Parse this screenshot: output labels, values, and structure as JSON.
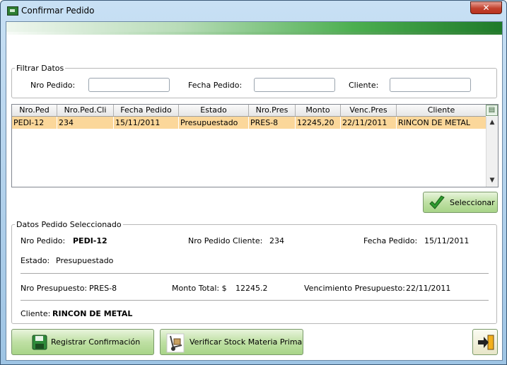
{
  "window": {
    "title": "Confirmar Pedido",
    "close_label": "✕"
  },
  "filter": {
    "legend": "Filtrar Datos",
    "nro_pedido_label": "Nro Pedido:",
    "nro_pedido_value": "",
    "fecha_pedido_label": "Fecha Pedido:",
    "fecha_pedido_value": "",
    "cliente_label": "Cliente:",
    "cliente_value": ""
  },
  "table": {
    "columns": [
      "Nro.Ped",
      "Nro.Ped.Cli",
      "Fecha Pedido",
      "Estado",
      "Nro.Pres",
      "Monto",
      "Venc.Pres",
      "Cliente"
    ],
    "rows": [
      [
        "PEDI-12",
        "234",
        "15/11/2011",
        "Presupuestado",
        "PRES-8",
        "12245,20",
        "22/11/2011",
        "RINCON DE METAL"
      ]
    ]
  },
  "seleccionar_label": "Seleccionar",
  "details": {
    "legend": "Datos Pedido Seleccionado",
    "nro_pedido_label": "Nro Pedido:",
    "nro_pedido_value": "PEDI-12",
    "nro_pedido_cliente_label": "Nro Pedido Cliente:",
    "nro_pedido_cliente_value": "234",
    "fecha_pedido_label": "Fecha Pedido:",
    "fecha_pedido_value": "15/11/2011",
    "estado_label": "Estado:",
    "estado_value": "Presupuestado",
    "nro_presupuesto_label": "Nro Presupuesto:",
    "nro_presupuesto_value": "PRES-8",
    "monto_total_label": "Monto Total: $",
    "monto_total_value": "12245.2",
    "vencimiento_label": "Vencimiento Presupuesto:",
    "vencimiento_value": "22/11/2011",
    "cliente_label": "Cliente:",
    "cliente_value": "RINCON DE METAL"
  },
  "buttons": {
    "registrar_label": "Registrar Confirmación",
    "verificar_label": "Verificar Stock Materia Prima"
  },
  "colors": {
    "selected_row": "#fbd79a",
    "button_green": "#bfe0a4",
    "banner_green": "#1f7a2a"
  }
}
